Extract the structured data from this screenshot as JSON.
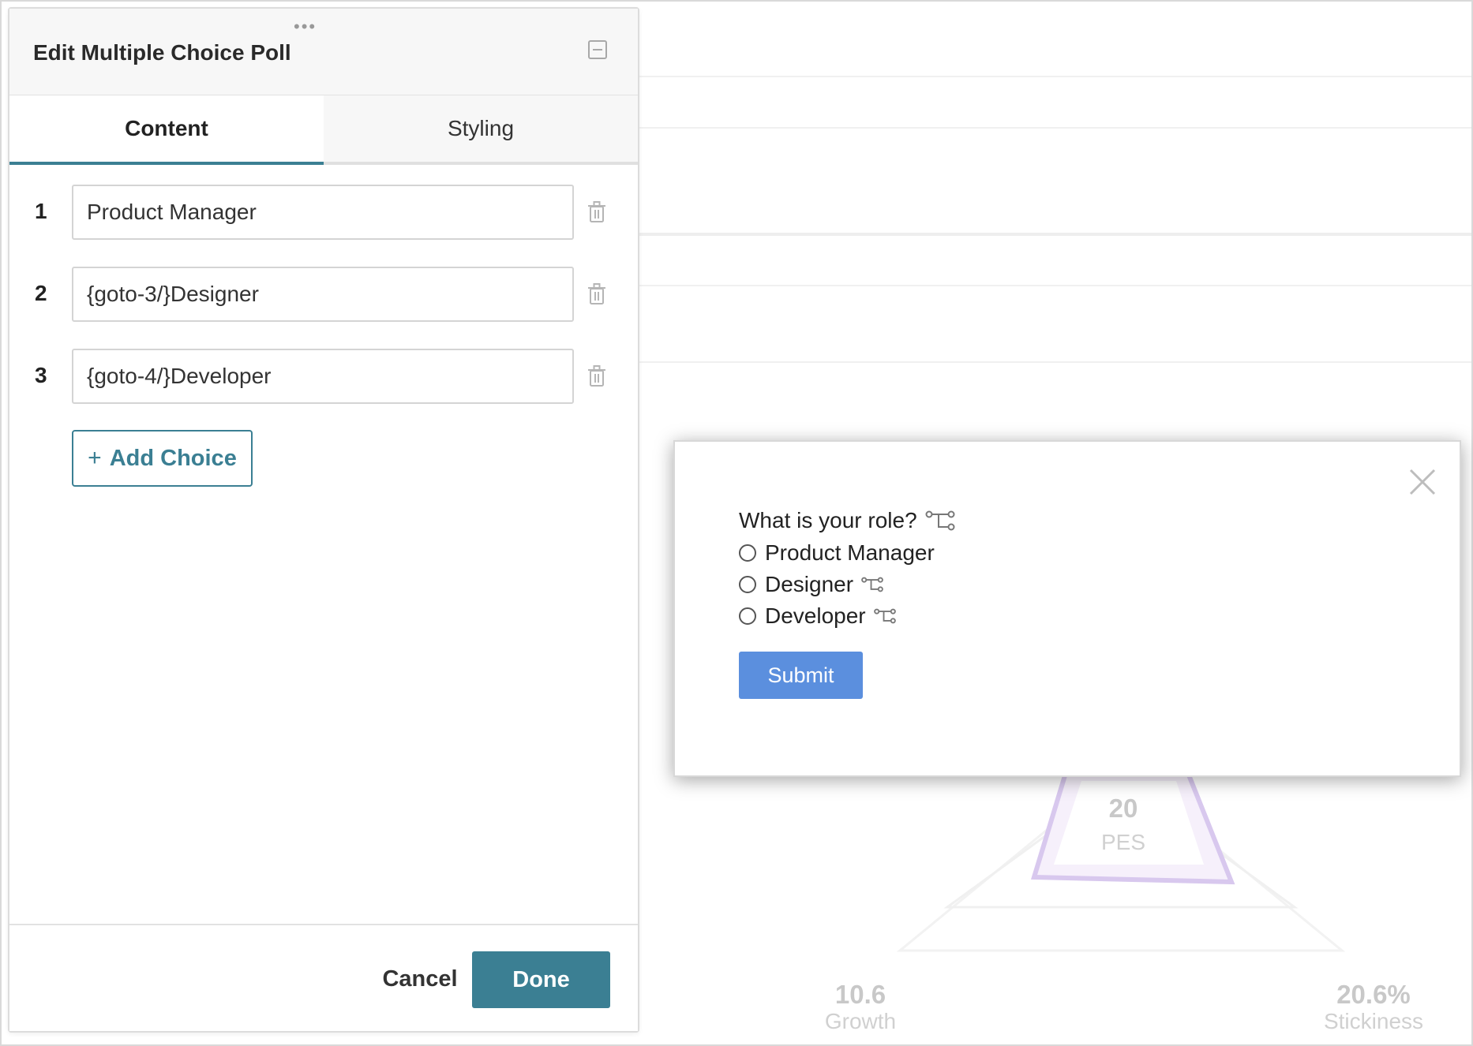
{
  "editor": {
    "title": "Edit Multiple Choice Poll",
    "tabs": [
      {
        "label": "Content",
        "active": true
      },
      {
        "label": "Styling",
        "active": false
      }
    ],
    "choices": [
      {
        "number": "1",
        "value": "Product Manager"
      },
      {
        "number": "2",
        "value": "{goto-3/}Designer"
      },
      {
        "number": "3",
        "value": "{goto-4/}Developer"
      }
    ],
    "add_choice_label": "Add Choice",
    "add_choice_icon": "+",
    "cancel_label": "Cancel",
    "done_label": "Done",
    "accent_color": "#3b7f93"
  },
  "poll": {
    "question": "What is your role?",
    "options": [
      {
        "label": "Product Manager",
        "has_branch": false
      },
      {
        "label": "Designer",
        "has_branch": true
      },
      {
        "label": "Developer",
        "has_branch": true
      }
    ],
    "submit_label": "Submit",
    "submit_color": "#5b8fde"
  },
  "background": {
    "pes_value": "20",
    "pes_label": "PES",
    "growth_value": "10.6",
    "growth_label": "Growth",
    "stickiness_value": "20.6%",
    "stickiness_label": "Stickiness"
  }
}
